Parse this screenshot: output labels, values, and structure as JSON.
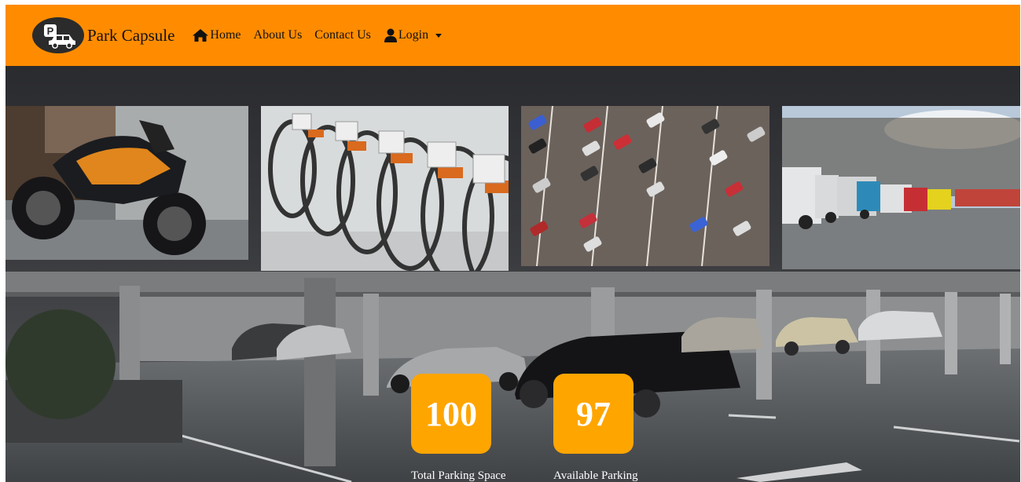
{
  "brand": {
    "name": "Park Capsule",
    "logo_icon": "car-parking-logo-icon"
  },
  "nav": {
    "home_label": "Home",
    "about_label": "About Us",
    "contact_label": "Contact Us",
    "login_label": "Login"
  },
  "gallery": [
    {
      "name": "motorcycle-image",
      "subject": "motorcycle"
    },
    {
      "name": "bicycles-image",
      "subject": "row of bicycles"
    },
    {
      "name": "car-parking-lot-image",
      "subject": "aerial car parking lot"
    },
    {
      "name": "truck-parking-image",
      "subject": "truck parking"
    }
  ],
  "stats": {
    "total": {
      "value": "100",
      "label": "Total Parking Space"
    },
    "available": {
      "value": "97",
      "label": "Available Parking"
    }
  },
  "colors": {
    "navbar": "#ff8c00",
    "stat_box": "#ffa500"
  }
}
